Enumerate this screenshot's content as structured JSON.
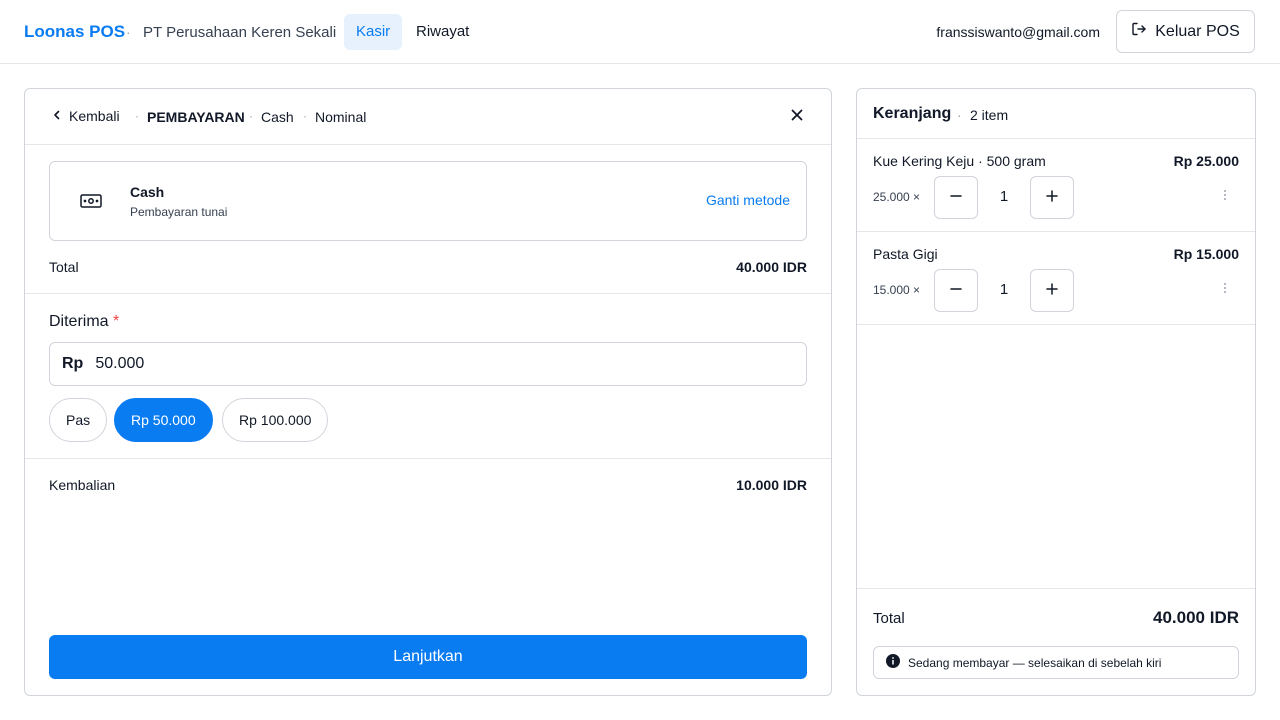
{
  "header": {
    "brand": "Loonas POS",
    "company": "PT Perusahaan Keren Sekali",
    "nav": [
      {
        "label": "Kasir",
        "active": true
      },
      {
        "label": "Riwayat",
        "active": false
      }
    ],
    "email": "franssiswanto@gmail.com",
    "logout_label": "Keluar POS"
  },
  "payment": {
    "back_label": "Kembali",
    "breadcrumb": [
      "PEMBAYARAN",
      "Cash",
      "Nominal"
    ],
    "method": {
      "icon": "cash-icon",
      "title": "Cash",
      "subtitle": "Pembayaran tunai",
      "change_label": "Ganti metode"
    },
    "total_label": "Total",
    "total_value": "40.000 IDR",
    "received_label": "Diterima",
    "received_required_mark": "*",
    "currency_prefix": "Rp",
    "received_value": "50.000",
    "quick_amounts": [
      {
        "label": "Pas",
        "active": false
      },
      {
        "label": "Rp 50.000",
        "active": true
      },
      {
        "label": "Rp 100.000",
        "active": false
      }
    ],
    "change_label": "Kembalian",
    "change_value": "10.000 IDR",
    "continue_label": "Lanjutkan"
  },
  "cart": {
    "title": "Keranjang",
    "count_label": "2 item",
    "items": [
      {
        "name": "Kue Kering Keju · 500 gram",
        "price": "Rp 25.000",
        "unit_price": "25.000 ×",
        "qty": "1"
      },
      {
        "name": "Pasta Gigi",
        "price": "Rp 15.000",
        "unit_price": "15.000 ×",
        "qty": "1"
      }
    ],
    "total_label": "Total",
    "total_value": "40.000 IDR",
    "notice": "Sedang membayar — selesaikan di sebelah kiri"
  },
  "colors": {
    "accent": "#0a7cf2",
    "accent_light": "#e6f1fd",
    "border": "#d1d5db",
    "required": "#ef4444"
  }
}
